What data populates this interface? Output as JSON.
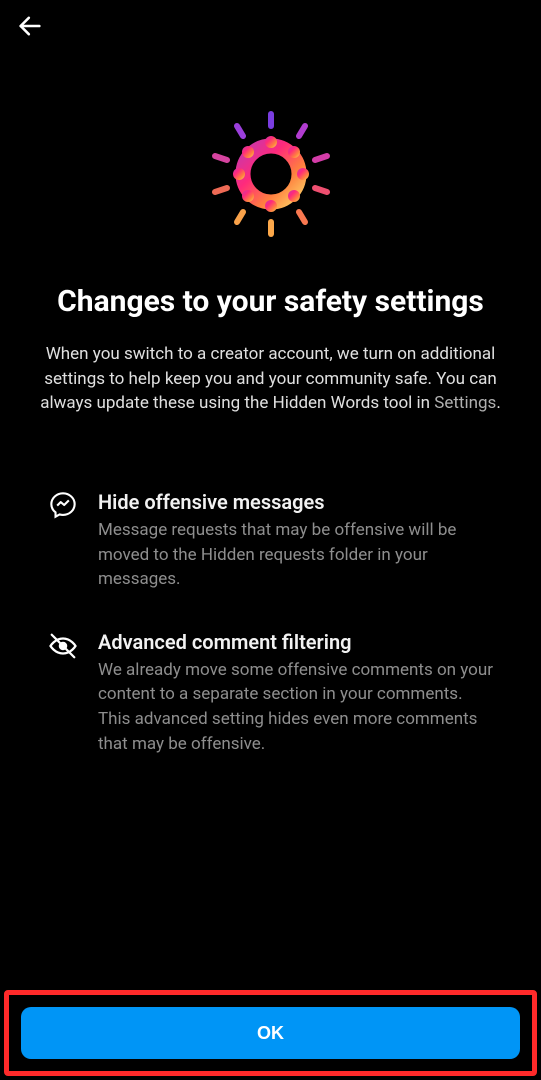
{
  "header": {
    "title": "Changes to your safety settings"
  },
  "subtitle": {
    "text_before": "When you switch to a creator account, we turn on additional settings to help keep you and your community safe. You can always update these using the Hidden Words tool in ",
    "link": "Settings",
    "text_after": "."
  },
  "features": [
    {
      "icon": "messenger-icon",
      "title": "Hide offensive messages",
      "desc": "Message requests that may be offensive will be moved to the Hidden requests folder in your messages."
    },
    {
      "icon": "eye-slash-icon",
      "title": "Advanced comment filtering",
      "desc": "We already move some offensive comments on your content to a separate section in your comments. This advanced setting hides even more comments that may be offensive."
    }
  ],
  "footer": {
    "ok_label": "OK"
  },
  "colors": {
    "accent": "#0095f6",
    "highlight_border": "#ff2a2a"
  }
}
